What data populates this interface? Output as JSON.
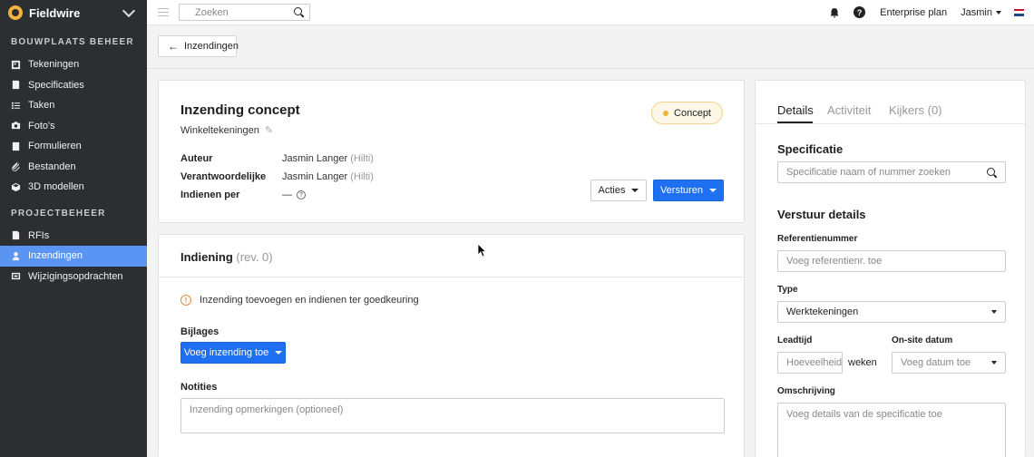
{
  "app": {
    "brand": "Fieldwire"
  },
  "sidebar": {
    "section1_title": "BOUWPLAATS BEHEER",
    "section1_items": [
      {
        "label": "Tekeningen",
        "icon": "drawings-icon"
      },
      {
        "label": "Specificaties",
        "icon": "specifications-icon"
      },
      {
        "label": "Taken",
        "icon": "tasks-icon"
      },
      {
        "label": "Foto's",
        "icon": "camera-icon"
      },
      {
        "label": "Formulieren",
        "icon": "forms-icon"
      },
      {
        "label": "Bestanden",
        "icon": "paperclip-icon"
      },
      {
        "label": "3D modellen",
        "icon": "cube-icon"
      }
    ],
    "section2_title": "PROJECTBEHEER",
    "section2_items": [
      {
        "label": "RFIs",
        "icon": "rfi-icon"
      },
      {
        "label": "Inzendingen",
        "icon": "submittals-icon",
        "active": true
      },
      {
        "label": "Wijzigingsopdrachten",
        "icon": "change-orders-icon"
      }
    ],
    "active_color": "#5b95f4"
  },
  "topbar": {
    "search_placeholder": "Zoeken",
    "plan": "Enterprise plan",
    "user": "Jasmin"
  },
  "back_button": "Inzendingen",
  "submittal": {
    "title": "Inzending concept",
    "subtitle": "Winkeltekeningen",
    "status": "Concept",
    "author_label": "Auteur",
    "author_name": "Jasmin Langer",
    "author_org": "(Hilti)",
    "responsible_label": "Verantwoordelijke",
    "responsible_name": "Jasmin Langer",
    "responsible_org": "(Hilti)",
    "due_label": "Indienen per",
    "due_value": "—",
    "actions_label": "Acties",
    "send_label": "Versturen"
  },
  "submission": {
    "title": "Indiening",
    "rev": "(rev. 0)",
    "notice": "Inzending toevoegen en indienen ter goedkeuring",
    "attachments_label": "Bijlages",
    "add_button": "Voeg inzending toe",
    "notes_label": "Notities",
    "notes_placeholder": "Inzending opmerkingen (optioneel)"
  },
  "details": {
    "tabs": [
      "Details",
      "Activiteit",
      "Kijkers (0)"
    ],
    "spec_heading": "Specificatie",
    "spec_placeholder": "Specificatie naam of nummer zoeken",
    "send_heading": "Verstuur details",
    "ref_label": "Referentienummer",
    "ref_placeholder": "Voeg referentienr. toe",
    "type_label": "Type",
    "type_value": "Werktekeningen",
    "lead_label": "Leadtijd",
    "lead_placeholder": "Hoeveelheid",
    "weeks": "weken",
    "onsite_label": "On-site datum",
    "onsite_placeholder": "Voeg datum toe",
    "desc_label": "Omschrijving",
    "desc_placeholder": "Voeg details van de specificatie toe"
  }
}
